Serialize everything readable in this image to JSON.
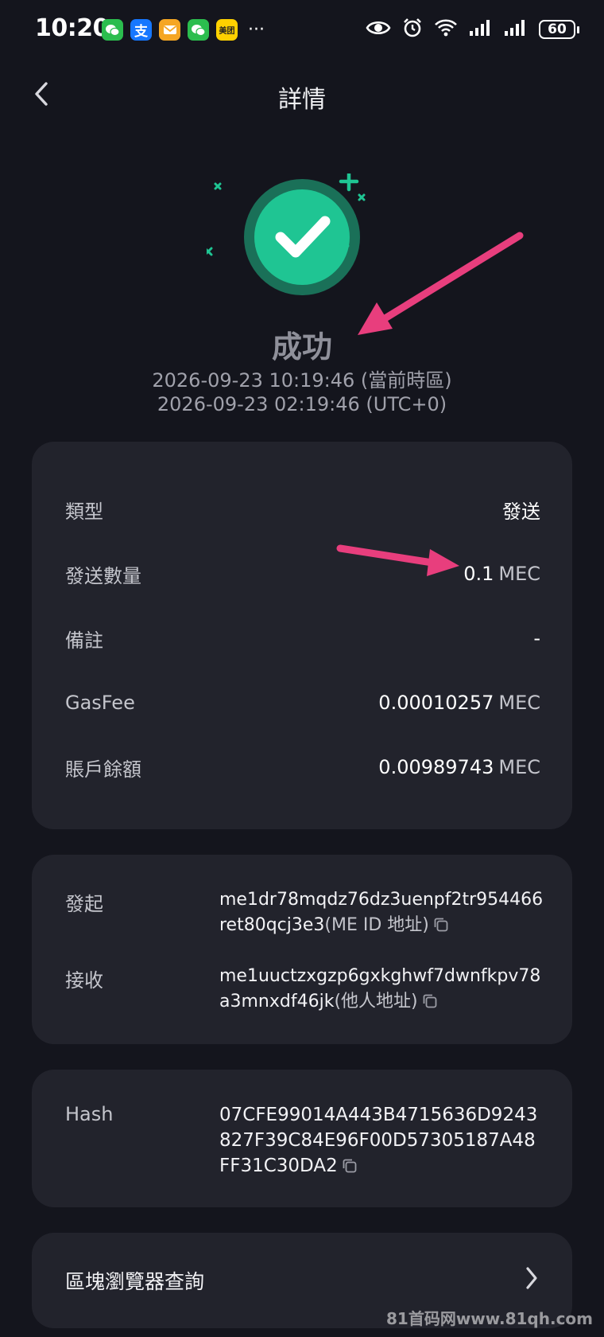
{
  "status_bar": {
    "time": "10:20",
    "notification_icons": [
      "wechat-icon",
      "alipay-icon",
      "mail-icon",
      "wechat-icon",
      "meituan-icon"
    ],
    "alipay_glyph": "支",
    "meituan_label": "美团",
    "more": "···",
    "battery": "60"
  },
  "header": {
    "title": "詳情"
  },
  "result": {
    "status": "成功",
    "time_local": "2026-09-23 10:19:46 (當前時區)",
    "time_utc": "2026-09-23 02:19:46 (UTC+0)"
  },
  "summary": {
    "type_label": "類型",
    "type_value": "發送",
    "amount_label": "發送數量",
    "amount_value": "0.1",
    "amount_unit": "MEC",
    "memo_label": "備註",
    "memo_value": "-",
    "fee_label": "GasFee",
    "fee_value": "0.00010257",
    "fee_unit": "MEC",
    "balance_label": "賬戶餘額",
    "balance_value": "0.00989743",
    "balance_unit": "MEC"
  },
  "addresses": {
    "from_label": "發起",
    "from_value": "me1dr78mqdz76dz3uenpf2tr954466ret80qcj3e3",
    "from_tag": "(ME ID 地址)",
    "to_label": "接收",
    "to_value": "me1uuctzxgzp6gxkghwf7dwnfkpv78a3mnxdf46jk",
    "to_tag": "(他人地址)"
  },
  "hash": {
    "label": "Hash",
    "value": "07CFE99014A443B4715636D9243827F39C84E96F00D57305187A48FF31C30DA2"
  },
  "explorer": {
    "label": "區塊瀏覽器查詢"
  },
  "watermark": "81首码网www.81qh.com",
  "colors": {
    "background": "#14151d",
    "card": "#22232c",
    "success": "#1fc593",
    "annotation_arrow": "#e83e7d"
  }
}
